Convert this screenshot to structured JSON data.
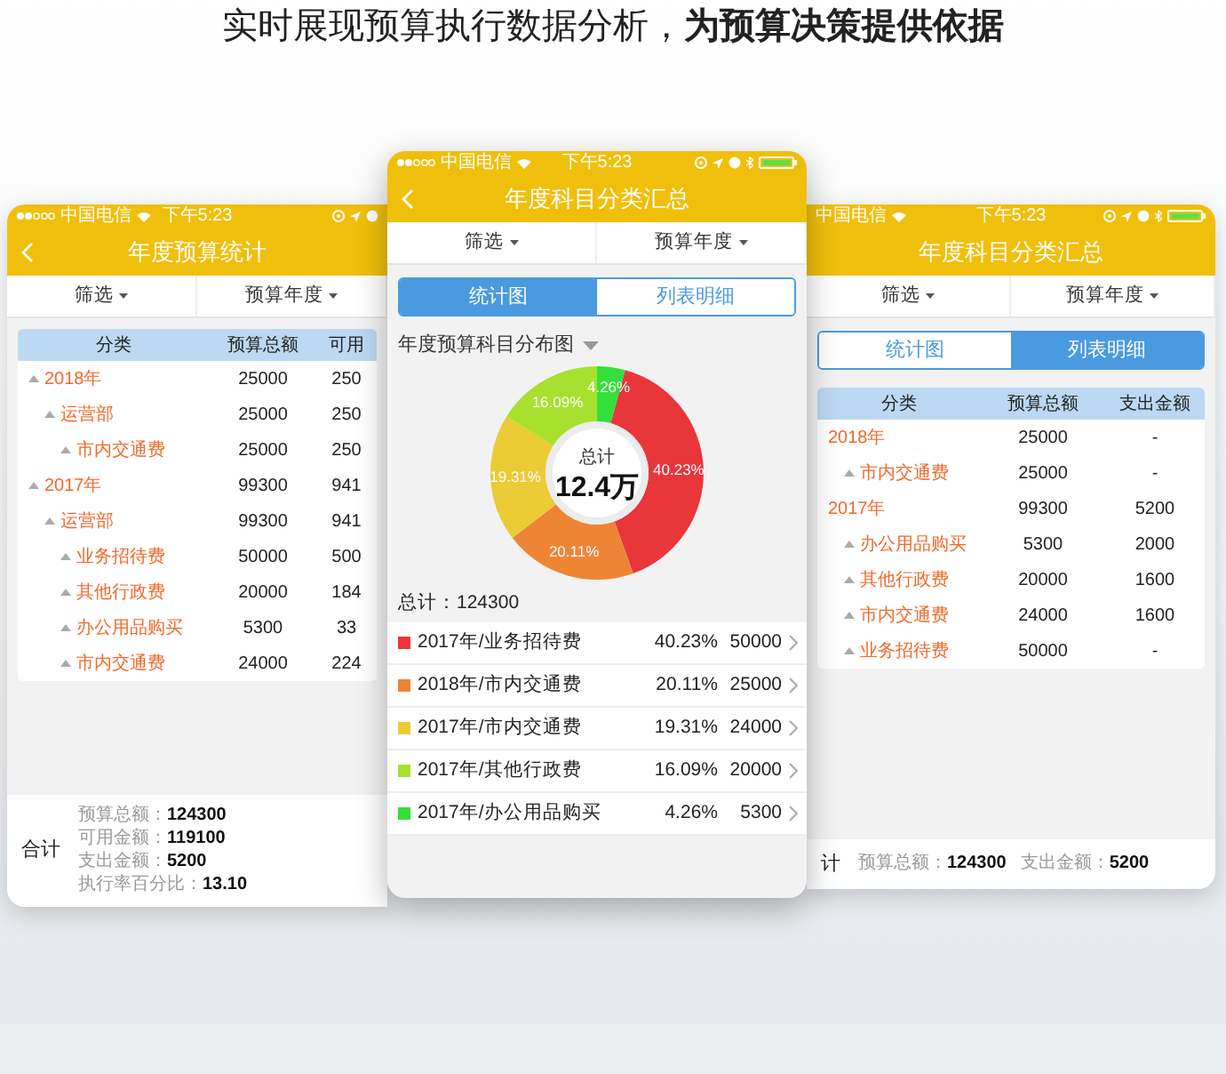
{
  "headline": "实时展现预算执行数据分析，**为预算决策提供依据**",
  "phones": [
    {
      "kind": "table",
      "status_bar": {
        "carrier": "中国电信",
        "time": "下午5:23"
      },
      "back_button": true,
      "title": "年度预算统计",
      "filters": [
        "筛选",
        "预算年度"
      ],
      "root_expander": true,
      "table": {
        "columns": [
          "分类",
          "预算总额",
          "可用"
        ],
        "rows": [
          {
            "cells": [
              "2018年",
              "25000",
              "250"
            ],
            "children": [
              {
                "cells": [
                  "运营部",
                  "25000",
                  "250"
                ],
                "children": [
                  {
                    "cells": [
                      "市内交通费",
                      "25000",
                      "250"
                    ]
                  }
                ]
              }
            ]
          },
          {
            "cells": [
              "2017年",
              "99300",
              "941"
            ],
            "children": [
              {
                "cells": [
                  "运营部",
                  "99300",
                  "941"
                ],
                "children": [
                  {
                    "cells": [
                      "业务招待费",
                      "50000",
                      "500"
                    ]
                  },
                  {
                    "cells": [
                      "其他行政费",
                      "20000",
                      "184"
                    ]
                  },
                  {
                    "cells": [
                      "办公用品购买",
                      "5300",
                      "33"
                    ]
                  },
                  {
                    "cells": [
                      "市内交通费",
                      "24000",
                      "224"
                    ]
                  }
                ]
              }
            ]
          }
        ]
      },
      "footer": {
        "label": "合计",
        "items": [
          {
            "label": "预算总额：",
            "value": "124300"
          },
          {
            "label": "可用金额：",
            "value": "119100"
          },
          {
            "label": "支出金额：",
            "value": "5200"
          },
          {
            "label": "执行率百分比：",
            "value": "13.10"
          }
        ]
      }
    },
    {
      "kind": "chart",
      "status_bar": {
        "carrier": "中国电信",
        "time": "下午5:23"
      },
      "back_button": true,
      "title": "年度科目分类汇总",
      "filters": [
        "筛选",
        "预算年度"
      ],
      "tabs": [
        {
          "label": "统计图",
          "selected": true
        },
        {
          "label": "列表明细",
          "selected": false
        }
      ],
      "chart_data": {
        "type": "donut",
        "title": "年度预算科目分布图",
        "values": [
          40.23,
          20.11,
          19.31,
          16.09,
          4.26
        ],
        "value_labels": [
          "40.23%",
          "20.11%",
          "19.31%",
          "16.09%",
          "4.26%"
        ]
      },
      "center": {
        "label": "总计",
        "value": "12.4万"
      },
      "total": "总计：124300",
      "items": [
        {
          "label": "2017年/业务招待费",
          "percent": "40.23%",
          "amount": "50000",
          "color": "#e8363a"
        },
        {
          "label": "2018年/市内交通费",
          "percent": "20.11%",
          "amount": "25000",
          "color": "#ee8535"
        },
        {
          "label": "2017年/市内交通费",
          "percent": "19.31%",
          "amount": "24000",
          "color": "#ebcb36"
        },
        {
          "label": "2017年/其他行政费",
          "percent": "16.09%",
          "amount": "20000",
          "color": "#a8e02f"
        },
        {
          "label": "2017年/办公用品购买",
          "percent": "4.26%",
          "amount": "5300",
          "color": "#33df3a"
        }
      ]
    },
    {
      "kind": "table",
      "status_bar": {
        "carrier": "中国电信",
        "time": "下午5:23"
      },
      "title": "年度科目分类汇总",
      "filters": [
        "筛选",
        "预算年度"
      ],
      "root_expander": false,
      "tabs": [
        {
          "label": "统计图",
          "selected": false
        },
        {
          "label": "列表明细",
          "selected": true
        }
      ],
      "table": {
        "columns": [
          "分类",
          "预算总额",
          "支出金额"
        ],
        "rows": [
          {
            "cells": [
              "2018年",
              "25000",
              "-"
            ],
            "children": [
              {
                "cells": [
                  "市内交通费",
                  "25000",
                  "-"
                ]
              }
            ]
          },
          {
            "cells": [
              "2017年",
              "99300",
              "5200"
            ],
            "children": [
              {
                "cells": [
                  "办公用品购买",
                  "5300",
                  "2000"
                ]
              },
              {
                "cells": [
                  "其他行政费",
                  "20000",
                  "1600"
                ]
              },
              {
                "cells": [
                  "市内交通费",
                  "24000",
                  "1600"
                ]
              },
              {
                "cells": [
                  "业务招待费",
                  "50000",
                  "-"
                ]
              }
            ]
          }
        ]
      },
      "footer": {
        "label": "计",
        "items": [
          {
            "label": "预算总额：",
            "value": "124300"
          },
          {
            "label": "支出金额：",
            "value": "5200"
          }
        ]
      }
    }
  ]
}
